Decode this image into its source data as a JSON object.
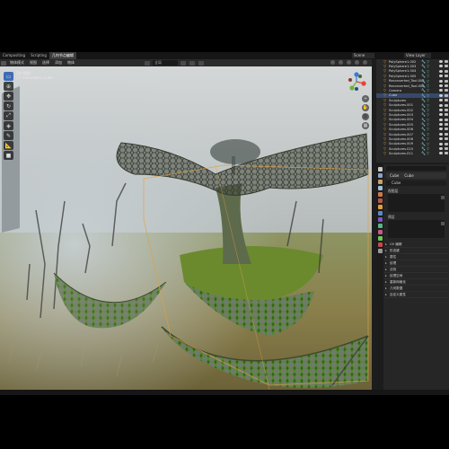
{
  "workspaces": [
    "Compositing",
    "Scripting",
    "几何节点编辑"
  ],
  "active_workspace_index": 2,
  "scene": "Scene",
  "view_layer": "View Layer",
  "viewport_header": {
    "menus": [
      "物体模式",
      "视图",
      "选择",
      "添加",
      "物体"
    ],
    "transform": "全局"
  },
  "viewport_info": [
    "用户透视",
    "(1) Collection | Cube"
  ],
  "toolbar_icons": [
    "select-box-icon",
    "cursor-icon",
    "move-icon",
    "rotate-icon",
    "scale-icon",
    "transform-icon",
    "annotate-icon",
    "measure-icon",
    "add-cube-icon"
  ],
  "nav_buttons": [
    "+",
    "✋",
    "🎥",
    "▦"
  ],
  "outliner": {
    "rows": [
      {
        "name": "PolySphere1.002",
        "selected": false
      },
      {
        "name": "PolySphere1.003",
        "selected": false
      },
      {
        "name": "PolySphere1.004",
        "selected": false
      },
      {
        "name": "PolySphere1.005",
        "selected": false
      },
      {
        "name": "Reconverted_Tool.003",
        "selected": false
      },
      {
        "name": "Reconverted_Tool.006",
        "selected": false
      },
      {
        "name": "Camera",
        "selected": false
      },
      {
        "name": "Cube",
        "selected": true
      },
      {
        "name": "Sculptures",
        "selected": false
      },
      {
        "name": "Sculptures.001",
        "selected": false
      },
      {
        "name": "Sculptures.002",
        "selected": false
      },
      {
        "name": "Sculptures.003",
        "selected": false
      },
      {
        "name": "Sculptures.004",
        "selected": false
      },
      {
        "name": "Sculptures.005",
        "selected": false
      },
      {
        "name": "Sculptures.006",
        "selected": false
      },
      {
        "name": "Sculptures.007",
        "selected": false
      },
      {
        "name": "Sculptures.008",
        "selected": false
      },
      {
        "name": "Sculptures.009",
        "selected": false
      },
      {
        "name": "Sculptures.010",
        "selected": false
      },
      {
        "name": "Sculptures.011",
        "selected": false
      }
    ]
  },
  "properties": {
    "object_name": "Cube",
    "material_label": "Cube",
    "sections": [
      "视图层",
      "预设"
    ],
    "panels": [
      "UV 编辑",
      "形态键",
      "属性",
      "纹理",
      "法线",
      "纹理空间",
      "重新网格化",
      "几何数据",
      "自定义属性"
    ]
  },
  "colors": {
    "selection": "#35496b",
    "active_tool": "#3f6bb5",
    "modifier": "#5ec4a0"
  }
}
